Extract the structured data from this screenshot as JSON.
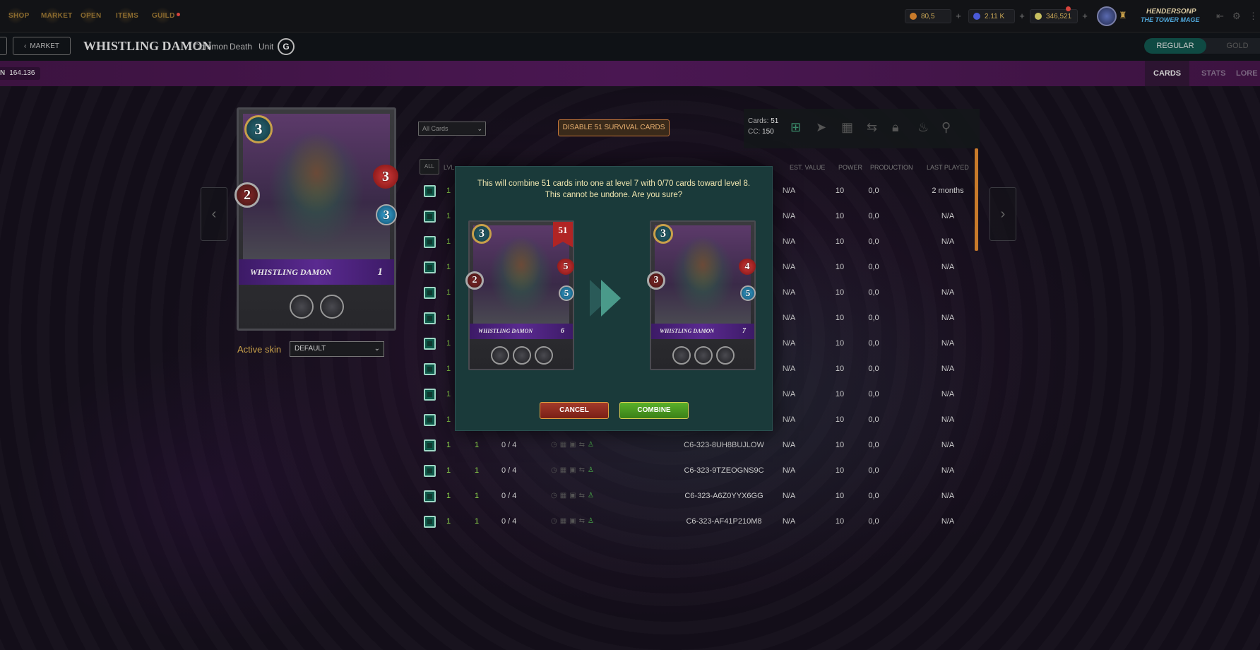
{
  "nav": {
    "items": [
      "SHOP",
      "MARKET",
      "OPEN",
      "ITEMS",
      "GUILD"
    ]
  },
  "resources": {
    "dec": "80,5",
    "credits": "2.11 K",
    "sps": "346,521"
  },
  "user": {
    "name": "HENDERSONP",
    "title": "THE TOWER MAGE"
  },
  "header": {
    "market_label": "MARKET",
    "card_name": "WHISTLING DAMON",
    "rarity": "Common",
    "element": "Death",
    "type": "Unit",
    "edition_glyph": "G",
    "toggle_regular": "REGULAR",
    "toggle_gold": "GOLD"
  },
  "band": {
    "burn_prefix": "N",
    "burn_value": "164.136",
    "tabs": [
      "CARDS",
      "STATS",
      "LORE"
    ]
  },
  "card": {
    "mana": "3",
    "melee": "2",
    "health": "3",
    "speed": "3",
    "name": "WHISTLING DAMON",
    "level": "1"
  },
  "skin": {
    "label": "Active skin",
    "value": "DEFAULT"
  },
  "table": {
    "filter": "All Cards",
    "disable_label": "DISABLE 51 SURVIVAL CARDS",
    "cards_label": "Cards:",
    "cards_value": "51",
    "cc_label": "CC:",
    "cc_value": "150",
    "all_label": "ALL",
    "lvl_label": "LVL",
    "headers": [
      "EST. VALUE",
      "POWER",
      "PRODUCTION",
      "LAST PLAYED"
    ],
    "upper_rows": [
      {
        "a": "1",
        "value": "N/A",
        "power": "10",
        "production": "0,0",
        "last": "2 months"
      },
      {
        "a": "1",
        "value": "N/A",
        "power": "10",
        "production": "0,0",
        "last": "N/A"
      },
      {
        "a": "1",
        "value": "N/A",
        "power": "10",
        "production": "0,0",
        "last": "N/A"
      },
      {
        "a": "1",
        "value": "N/A",
        "power": "10",
        "production": "0,0",
        "last": "N/A"
      },
      {
        "a": "1",
        "value": "N/A",
        "power": "10",
        "production": "0,0",
        "last": "N/A"
      },
      {
        "a": "1",
        "value": "N/A",
        "power": "10",
        "production": "0,0",
        "last": "N/A"
      },
      {
        "a": "1",
        "value": "N/A",
        "power": "10",
        "production": "0,0",
        "last": "N/A"
      },
      {
        "a": "1",
        "value": "N/A",
        "power": "10",
        "production": "0,0",
        "last": "N/A"
      },
      {
        "a": "1",
        "value": "N/A",
        "power": "10",
        "production": "0,0",
        "last": "N/A"
      },
      {
        "a": "1",
        "value": "N/A",
        "power": "10",
        "production": "0,0",
        "last": "N/A"
      }
    ],
    "lower_rows": [
      {
        "a": "1",
        "lvl": "1",
        "xp": "0 / 4",
        "uid": "C6-323-8UH8BUJLOW",
        "value": "N/A",
        "power": "10",
        "production": "0,0",
        "last": "N/A"
      },
      {
        "a": "1",
        "lvl": "1",
        "xp": "0 / 4",
        "uid": "C6-323-9TZEOGNS9C",
        "value": "N/A",
        "power": "10",
        "production": "0,0",
        "last": "N/A"
      },
      {
        "a": "1",
        "lvl": "1",
        "xp": "0 / 4",
        "uid": "C6-323-A6Z0YYX6GG",
        "value": "N/A",
        "power": "10",
        "production": "0,0",
        "last": "N/A"
      },
      {
        "a": "1",
        "lvl": "1",
        "xp": "0 / 4",
        "uid": "C6-323-AF41P210M8",
        "value": "N/A",
        "power": "10",
        "production": "0,0",
        "last": "N/A"
      }
    ]
  },
  "modal": {
    "message_line1": "This will combine 51 cards into one at level 7 with 0/70 cards toward level 8.",
    "message_line2": "This cannot be undone. Are you sure?",
    "before": {
      "mana": "3",
      "melee": "2",
      "health": "5",
      "speed": "5",
      "name": "WHISTLING DAMON",
      "level": "6",
      "count": "51"
    },
    "after": {
      "mana": "3",
      "melee": "3",
      "health": "4",
      "speed": "5",
      "name": "WHISTLING DAMON",
      "level": "7"
    },
    "cancel_label": "CANCEL",
    "combine_label": "COMBINE"
  },
  "colors": {
    "accent_green": "#5ab02a",
    "cancel_red": "#a33a2a",
    "modal_bg": "#1a3a3a",
    "brand_orange": "#c8783a"
  }
}
